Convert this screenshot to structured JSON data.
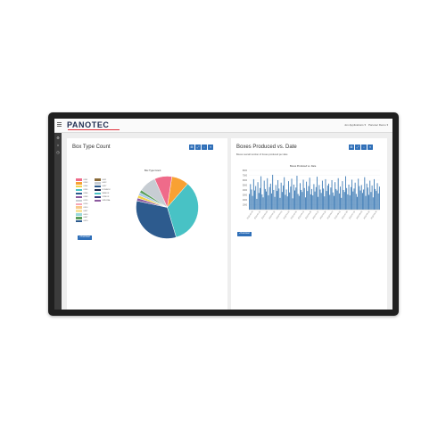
{
  "app": {
    "logo": "PANOTEC",
    "user_menu": "Jon Applications ▾",
    "account_menu": "Panotec Demo ▾"
  },
  "colors": {
    "primary": "#2f6fb8",
    "logo": "#1d2b4f",
    "bar": "#3f7cb6",
    "bezel": "#1f1f1f"
  },
  "sidenav": {
    "items": [
      {
        "icon": "gear-icon",
        "glyph": "⚙"
      },
      {
        "icon": "home-icon",
        "glyph": "⌂"
      },
      {
        "icon": "clock-icon",
        "glyph": "◷"
      }
    ]
  },
  "left_panel": {
    "title": "Box Type Count",
    "download_label": "▪ Download",
    "tools": [
      "⊞",
      "⤢",
      "↓",
      "≡"
    ]
  },
  "right_panel": {
    "title": "Boxes Produced vs. Date",
    "subtitle": "Boxes overall number of boxes produced per date",
    "download_label": "▪ Download",
    "tools": [
      "⊞",
      "⤢",
      "↓",
      "≡"
    ]
  },
  "chart_data": [
    {
      "type": "pie",
      "title": "Box Type Count",
      "legend_position": "left",
      "slices": [
        {
          "label": "0201",
          "value": 9,
          "color": "#f8a133"
        },
        {
          "label": "0203",
          "value": 34,
          "color": "#48c2c5"
        },
        {
          "label": "0204",
          "value": 33,
          "color": "#2d5b8e"
        },
        {
          "label": "0205",
          "value": 1.5,
          "color": "#8c5a9f"
        },
        {
          "label": "0206",
          "value": 1.5,
          "color": "#f3d34a"
        },
        {
          "label": "0209",
          "value": 1.5,
          "color": "#a8c8e8"
        },
        {
          "label": "0215",
          "value": 1.5,
          "color": "#5a9e5a"
        },
        {
          "label": "0216",
          "value": 9,
          "color": "#c7cdd3"
        },
        {
          "label": "0310",
          "value": 9,
          "color": "#ef6b8a"
        }
      ],
      "legend_col1": [
        {
          "label": "0201",
          "color": "#ef6b8a"
        },
        {
          "label": "0203",
          "color": "#f8a133"
        },
        {
          "label": "0204",
          "color": "#f3d34a"
        },
        {
          "label": "0205",
          "color": "#48c2c5"
        },
        {
          "label": "0206",
          "color": "#2d5b8e"
        },
        {
          "label": "0209",
          "color": "#8c5a9f"
        },
        {
          "label": "0215",
          "color": "#c7cdd3"
        },
        {
          "label": "0216",
          "color": "#f6a6b8"
        },
        {
          "label": "0310",
          "color": "#f9c98a"
        },
        {
          "label": "0427",
          "color": "#f8e39a"
        },
        {
          "label": "0410",
          "color": "#9ad8da"
        },
        {
          "label": "0437",
          "color": "#5a9e5a"
        },
        {
          "label": "0470",
          "color": "#2d5b8e"
        }
      ],
      "legend_col2": [
        {
          "label": "0411",
          "color": "#8a6b3a"
        },
        {
          "label": "0412",
          "color": "#c7cdd3"
        },
        {
          "label": "0427",
          "color": "#2d5b8e"
        },
        {
          "label": "FOSBOX",
          "color": "#1d2b4f"
        },
        {
          "label": "MFBOX",
          "color": "#48c2c5"
        },
        {
          "label": "OPBOX",
          "color": "#3a3a7a"
        },
        {
          "label": "SPECIAL",
          "color": "#8c5a9f"
        }
      ]
    },
    {
      "type": "bar",
      "title": "Boxes Produced vs. Date",
      "ylabel": "",
      "ylim": [
        0,
        8000
      ],
      "yticks": [
        "8000",
        "7000",
        "6000",
        "5000",
        "4000",
        "3000",
        "2000",
        "1000"
      ],
      "xticks": [
        "2016-01-05",
        "2016-01-19",
        "2016-02-02",
        "2016-02-16",
        "2016-03-01",
        "2016-03-15",
        "2016-03-29",
        "2016-04-12",
        "2016-04-26",
        "2016-05-10",
        "2016-05-24",
        "2016-06-07",
        "2016-06-21",
        "2016-07-05",
        "2016-07-19",
        "2016-08-02",
        "2016-08-16",
        "2016-08-30"
      ],
      "values": [
        3200,
        5200,
        4100,
        2800,
        6200,
        3900,
        4800,
        2200,
        5600,
        3400,
        4400,
        6800,
        3100,
        2500,
        5900,
        4200,
        3700,
        6400,
        2900,
        4600,
        5300,
        3300,
        7100,
        4000,
        2600,
        5000,
        3800,
        6000,
        4300,
        2400,
        5500,
        3600,
        4900,
        6600,
        3000,
        4100,
        2700,
        5800,
        3500,
        4700,
        6300,
        2300,
        5100,
        3900,
        4500,
        6900,
        3200,
        2800,
        5400,
        4000,
        3600,
        6100,
        4400,
        2500,
        5700,
        3800,
        4800,
        6500,
        3100,
        4200,
        2900,
        5200,
        3700,
        4600,
        6700,
        2600,
        5000,
        4100,
        3400,
        5900,
        4300,
        2700,
        6200,
        3800,
        4900,
        5300,
        3000,
        4500,
        6000,
        3500,
        2800,
        5600,
        4200,
        3900,
        6400,
        3300,
        4700,
        2400,
        5800,
        4000,
        3600,
        6800,
        4400,
        3100,
        5100,
        2900,
        4600,
        6100,
        3700,
        4300,
        5500,
        3200,
        2600,
        6300,
        4800,
        3900,
        5000,
        3400,
        4100,
        6600,
        2800,
        5300,
        4500,
        3000,
        5900,
        3600,
        4900,
        2500,
        6200,
        4200,
        3800,
        5400,
        3300,
        4700
      ]
    }
  ]
}
